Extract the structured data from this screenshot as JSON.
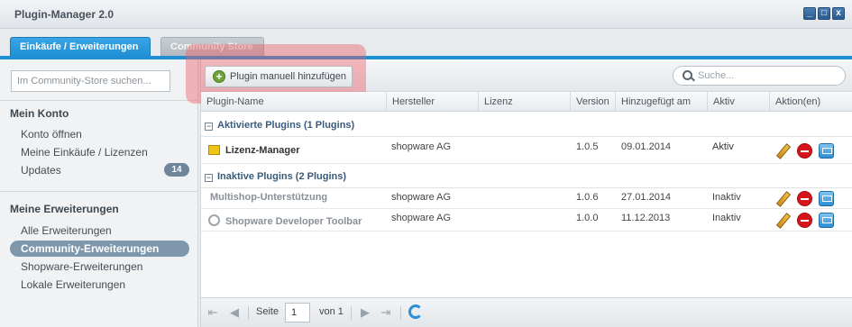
{
  "window": {
    "title": "Plugin-Manager 2.0",
    "controls": [
      "_",
      "□",
      "x"
    ]
  },
  "tabs": [
    {
      "label": "Einkäufe / Erweiterungen",
      "active": true
    },
    {
      "label": "Community Store",
      "active": false
    }
  ],
  "sidebar": {
    "search_placeholder": "Im Community-Store suchen...",
    "section1": {
      "heading": "Mein Konto",
      "items": [
        {
          "label": "Konto öffnen"
        },
        {
          "label": "Meine Einkäufe / Lizenzen"
        },
        {
          "label": "Updates",
          "badge": "14"
        }
      ]
    },
    "section2": {
      "heading": "Meine Erweiterungen",
      "items": [
        {
          "label": "Alle Erweiterungen"
        },
        {
          "label": "Community-Erweiterungen",
          "active": true
        },
        {
          "label": "Shopware-Erweiterungen"
        },
        {
          "label": "Lokale Erweiterungen"
        }
      ]
    }
  },
  "toolbar": {
    "add_button": "Plugin manuell hinzufügen",
    "search_placeholder": "Suche..."
  },
  "grid": {
    "columns": [
      "Plugin-Name",
      "Hersteller",
      "Lizenz",
      "Version",
      "Hinzugefügt am",
      "Aktiv",
      "Aktion(en)"
    ],
    "groups": [
      {
        "label": "Aktivierte Plugins (1 Plugins)",
        "rows": [
          {
            "name": "Lizenz-Manager",
            "vendor": "shopware AG",
            "license": "",
            "version": "1.0.5",
            "added": "09.01.2014",
            "active": "Aktiv",
            "icon": "license-icon"
          }
        ]
      },
      {
        "label": "Inaktive Plugins (2 Plugins)",
        "rows": [
          {
            "name": "Multishop-Unterstützung",
            "vendor": "shopware AG",
            "license": "",
            "version": "1.0.6",
            "added": "27.01.2014",
            "active": "Inaktiv"
          },
          {
            "name": "Shopware Developer Toolbar",
            "vendor": "shopware AG",
            "license": "",
            "version": "1.0.0",
            "added": "11.12.2013",
            "active": "Inaktiv",
            "icon": "fingerprint-icon"
          }
        ]
      }
    ]
  },
  "pager": {
    "page_label": "Seite",
    "page": "1",
    "of_label": "von 1"
  },
  "colors": {
    "accent": "#1f8fd3",
    "highlight": "#ec5a64",
    "sidebar_active": "#7f97ad"
  }
}
